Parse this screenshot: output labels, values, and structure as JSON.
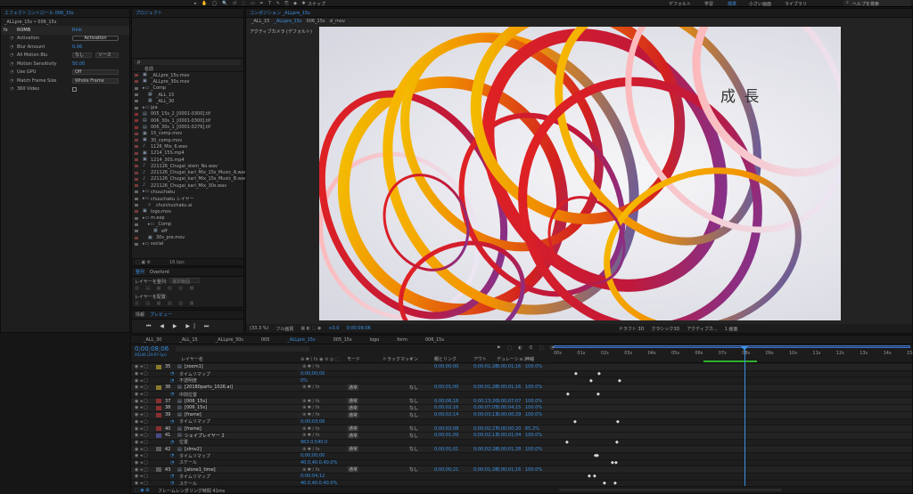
{
  "topbar": {
    "left_icons": "▸ ✋ ◯ 🔍 ↺ ⬚ ▭ ✒ T ✎ ⎘ ◆ ✱",
    "snap": "スナップ",
    "workspaces": [
      "デフォルト",
      "学習",
      "標準",
      "小さい画面",
      "ライブラリ"
    ],
    "active_workspace": "標準",
    "search": "ヘルプを検索"
  },
  "effects": {
    "tab": "エフェクトコントロール 006_15s",
    "breadcrumb": "_ALLpre_15s • 006_15s",
    "layer": "ROMB",
    "reset": "Rink",
    "rows": [
      {
        "label": "Activation",
        "value": "Activation",
        "kind": "button"
      },
      {
        "label": "Blur Amount",
        "value": "0.06",
        "kind": "num"
      },
      {
        "label": "All Motion Blu",
        "value": "なし",
        "kind": "dd2",
        "value2": "ソース"
      },
      {
        "label": "Motion Sensitivity",
        "value": "50.00",
        "kind": "num"
      },
      {
        "label": "Use GPU",
        "value": "Off",
        "kind": "dd"
      },
      {
        "label": "Match Frame Size",
        "value": "Whole Frame",
        "kind": "dd"
      },
      {
        "label": "360 Video",
        "value": "",
        "kind": "check"
      }
    ]
  },
  "project": {
    "tab": "プロジェクト",
    "search_placeholder": "ρ",
    "header": "名前",
    "items": [
      {
        "name": "_ALLpre_15s.mov",
        "type": "video",
        "color": "#7a3a3a",
        "indent": 0
      },
      {
        "name": "_ALLpre_30s.mov",
        "type": "video",
        "color": "#7a3a3a",
        "indent": 0
      },
      {
        "name": "_Comp",
        "type": "folder",
        "color": "#666",
        "indent": 0
      },
      {
        "name": "_ALL_15",
        "type": "comp",
        "color": "#666",
        "indent": 1
      },
      {
        "name": "_ALL_30",
        "type": "comp",
        "color": "#666",
        "indent": 1
      },
      {
        "name": "jpa",
        "type": "folder",
        "color": "#666",
        "indent": 0
      },
      {
        "name": "005_15s_2_[0001-0300].tif",
        "type": "image",
        "color": "#8a2f2f",
        "indent": 0
      },
      {
        "name": "006_30s_1_[0001-0300].tif",
        "type": "image",
        "color": "#8a2f2f",
        "indent": 0
      },
      {
        "name": "006_30s_1_[0001-0276].tif",
        "type": "image",
        "color": "#8a2f2f",
        "indent": 0
      },
      {
        "name": "15_comp.mov",
        "type": "video",
        "color": "#7a3a3a",
        "indent": 0
      },
      {
        "name": "30_comp.mov",
        "type": "video",
        "color": "#7a3a3a",
        "indent": 0
      },
      {
        "name": "1126_Mix_6.wav",
        "type": "audio",
        "color": "#7a3a3a",
        "indent": 0
      },
      {
        "name": "1214_15S.mp4",
        "type": "video",
        "color": "#7a3a3a",
        "indent": 0
      },
      {
        "name": "1214_30S.mp4",
        "type": "video",
        "color": "#7a3a3a",
        "indent": 0
      },
      {
        "name": "221126_Chugai_stem_No.wav",
        "type": "audio",
        "color": "#7a3a3a",
        "indent": 0
      },
      {
        "name": "221126_Chugai_karl_Mix_15s_Music_A.wav",
        "type": "audio",
        "color": "#7a3a3a",
        "indent": 0
      },
      {
        "name": "221126_Chugai_karl_Mix_15s_Music_B.wav",
        "type": "audio",
        "color": "#7a3a3a",
        "indent": 0
      },
      {
        "name": "221126_Chugai_karl_Mix_30s.wav",
        "type": "audio",
        "color": "#7a3a3a",
        "indent": 0
      },
      {
        "name": "chuuchaku",
        "type": "folder",
        "color": "#666",
        "indent": 0
      },
      {
        "name": "chuuchaku レイヤー",
        "type": "folder",
        "color": "#666",
        "indent": 0
      },
      {
        "name": "chuichuchaku.ai",
        "type": "file",
        "color": "#666",
        "indent": 1
      },
      {
        "name": "logo.mov",
        "type": "video",
        "color": "#7a3a3a",
        "indent": 0
      },
      {
        "name": "m.exp",
        "type": "folder",
        "color": "#666",
        "indent": 0
      },
      {
        "name": "_Comp",
        "type": "folder",
        "color": "#666",
        "indent": 1
      },
      {
        "name": "eff",
        "type": "comp",
        "color": "#666",
        "indent": 2
      },
      {
        "name": "30s_pre.mov",
        "type": "video",
        "color": "#7a3a3a",
        "indent": 1
      },
      {
        "name": "social",
        "type": "folder",
        "color": "#666",
        "indent": 0
      }
    ],
    "footer": "16 bpc"
  },
  "align": {
    "tabs": [
      "整列",
      "Overlord"
    ],
    "label1": "レイヤーを整列:",
    "dropdown": "選択範囲",
    "label2": "レイヤーを配置:"
  },
  "preview": {
    "tabs": [
      "情報",
      "プレビュー"
    ]
  },
  "comp": {
    "tab": "コンポジション _ALLpre_15s",
    "breadcrumbs": [
      "_ALL_15",
      "_ALLpre_15s",
      "006_15s",
      "zl_mov"
    ],
    "camera": "アクティブカメラ (デフォルト)",
    "overlay_text": "成 長",
    "footer": {
      "zoom": "(33.3 %)",
      "quality": "フル画質",
      "offset": "+0.0",
      "timecode": "0;00;08;06",
      "view1": "ドラフト 3D",
      "view2": "クラシック3D",
      "view3": "アクティブカ...",
      "view4": "1 画面"
    }
  },
  "timeline": {
    "tabs": [
      "_ALL_30",
      "_ALL_15",
      "_ALLpre_30s",
      "005",
      "_ALLpre_15s",
      "005_15s",
      "logo",
      "form",
      "006_15s"
    ],
    "active_tab": "_ALLpre_15s",
    "timecode": "0;00;08;06",
    "fps": "00246 (29.97 fps)",
    "headers": {
      "name": "レイヤー名",
      "mode": "モード",
      "trkmat": "トラックマット",
      "parent": "親とリンク",
      "in": "イン",
      "out": "アウト",
      "dur": "デュレーション",
      "stretch": "伸縮"
    },
    "ruler": [
      "00s",
      "01s",
      "02s",
      "03s",
      "04s",
      "05s",
      "06s",
      "07s",
      "08s",
      "09s",
      "10s",
      "11s",
      "12s",
      "13s",
      "14s",
      "15s"
    ],
    "rows": [
      {
        "num": "35",
        "name": "[zoom1]",
        "mode": "",
        "parent": "",
        "in": "0;00;00;00",
        "out": "0;00;01;28",
        "dur": "0;00;01;16",
        "stretch": "100.0%",
        "color": "#8a7a2a",
        "kind": "layer"
      },
      {
        "num": "",
        "name": "タイムリマップ",
        "sub": "0;00;00;00",
        "kind": "prop"
      },
      {
        "num": "",
        "name": "不透明度",
        "sub": "0%",
        "kind": "prop"
      },
      {
        "num": "36",
        "name": "[20180parts_1026.ai]",
        "mode": "通常",
        "parent": "なし",
        "in": "0;00;01;00",
        "out": "0;00;01;28",
        "dur": "0;00;01;16",
        "stretch": "100.0%",
        "color": "#8a7a2a",
        "kind": "layer"
      },
      {
        "num": "",
        "name": "中間位置",
        "sub": "",
        "kind": "prop"
      },
      {
        "num": "37",
        "name": "[006_15s]",
        "mode": "通常",
        "parent": "なし",
        "in": "0;00;06;16",
        "out": "0;00;13;20",
        "dur": "0;00;07;07",
        "stretch": "100.0%",
        "color": "#8a2f2f",
        "kind": "layer"
      },
      {
        "num": "38",
        "name": "[006_15s]",
        "mode": "通常",
        "parent": "なし",
        "in": "0;00;02;16",
        "out": "0;00;07;05",
        "dur": "0;00;04;15",
        "stretch": "100.0%",
        "color": "#8a2f2f",
        "kind": "layer"
      },
      {
        "num": "39",
        "name": "[frame]",
        "mode": "通常",
        "parent": "なし",
        "in": "0;00;02;14",
        "out": "0;00;03;13",
        "dur": "0;00;00;29",
        "stretch": "100.0%",
        "color": "#8a2f2f",
        "kind": "layer"
      },
      {
        "num": "",
        "name": "タイムリマップ",
        "sub": "0;00;03;06",
        "kind": "prop"
      },
      {
        "num": "40",
        "name": "[frame]",
        "mode": "通常",
        "parent": "なし",
        "in": "0;00;02;08",
        "out": "0;00;02;27",
        "dur": "0;00;00;20",
        "stretch": "65.2%",
        "color": "#8a2f2f",
        "kind": "layer"
      },
      {
        "num": "41",
        "name": "シェイプレイヤー 2",
        "mode": "通常",
        "parent": "なし",
        "in": "0;00;01;09",
        "out": "0;00;02;13",
        "dur": "0;00;01;04",
        "stretch": "100.0%",
        "color": "#4a4a8a",
        "kind": "layer"
      },
      {
        "num": "",
        "name": "位置",
        "sub": "963.0,540.0",
        "kind": "prop"
      },
      {
        "num": "42",
        "name": "[zlmv2]",
        "mode": "通常",
        "parent": "なし",
        "in": "0;00;01;01",
        "out": "0;00;02;28",
        "dur": "0;00;01;28",
        "stretch": "100.0%",
        "color": "#5a5a5a",
        "kind": "layer"
      },
      {
        "num": "",
        "name": "タイムリマップ",
        "sub": "0;00;00;00",
        "kind": "prop"
      },
      {
        "num": "",
        "name": "スケール",
        "sub": "40.0,40.0,40.0%",
        "kind": "prop"
      },
      {
        "num": "43",
        "name": "[alone1_time]",
        "mode": "通常",
        "parent": "なし",
        "in": "0;00;00;21",
        "out": "0;00;01;28",
        "dur": "0;00;01;16",
        "stretch": "100.0%",
        "color": "#5a5a5a",
        "kind": "layer"
      },
      {
        "num": "",
        "name": "タイムリマップ",
        "sub": "0;00;04;12",
        "kind": "prop"
      },
      {
        "num": "",
        "name": "スケール",
        "sub": "40.0,40.0,40.0%",
        "kind": "prop"
      }
    ],
    "footer": "フレームレンダリング時間 41ms"
  }
}
